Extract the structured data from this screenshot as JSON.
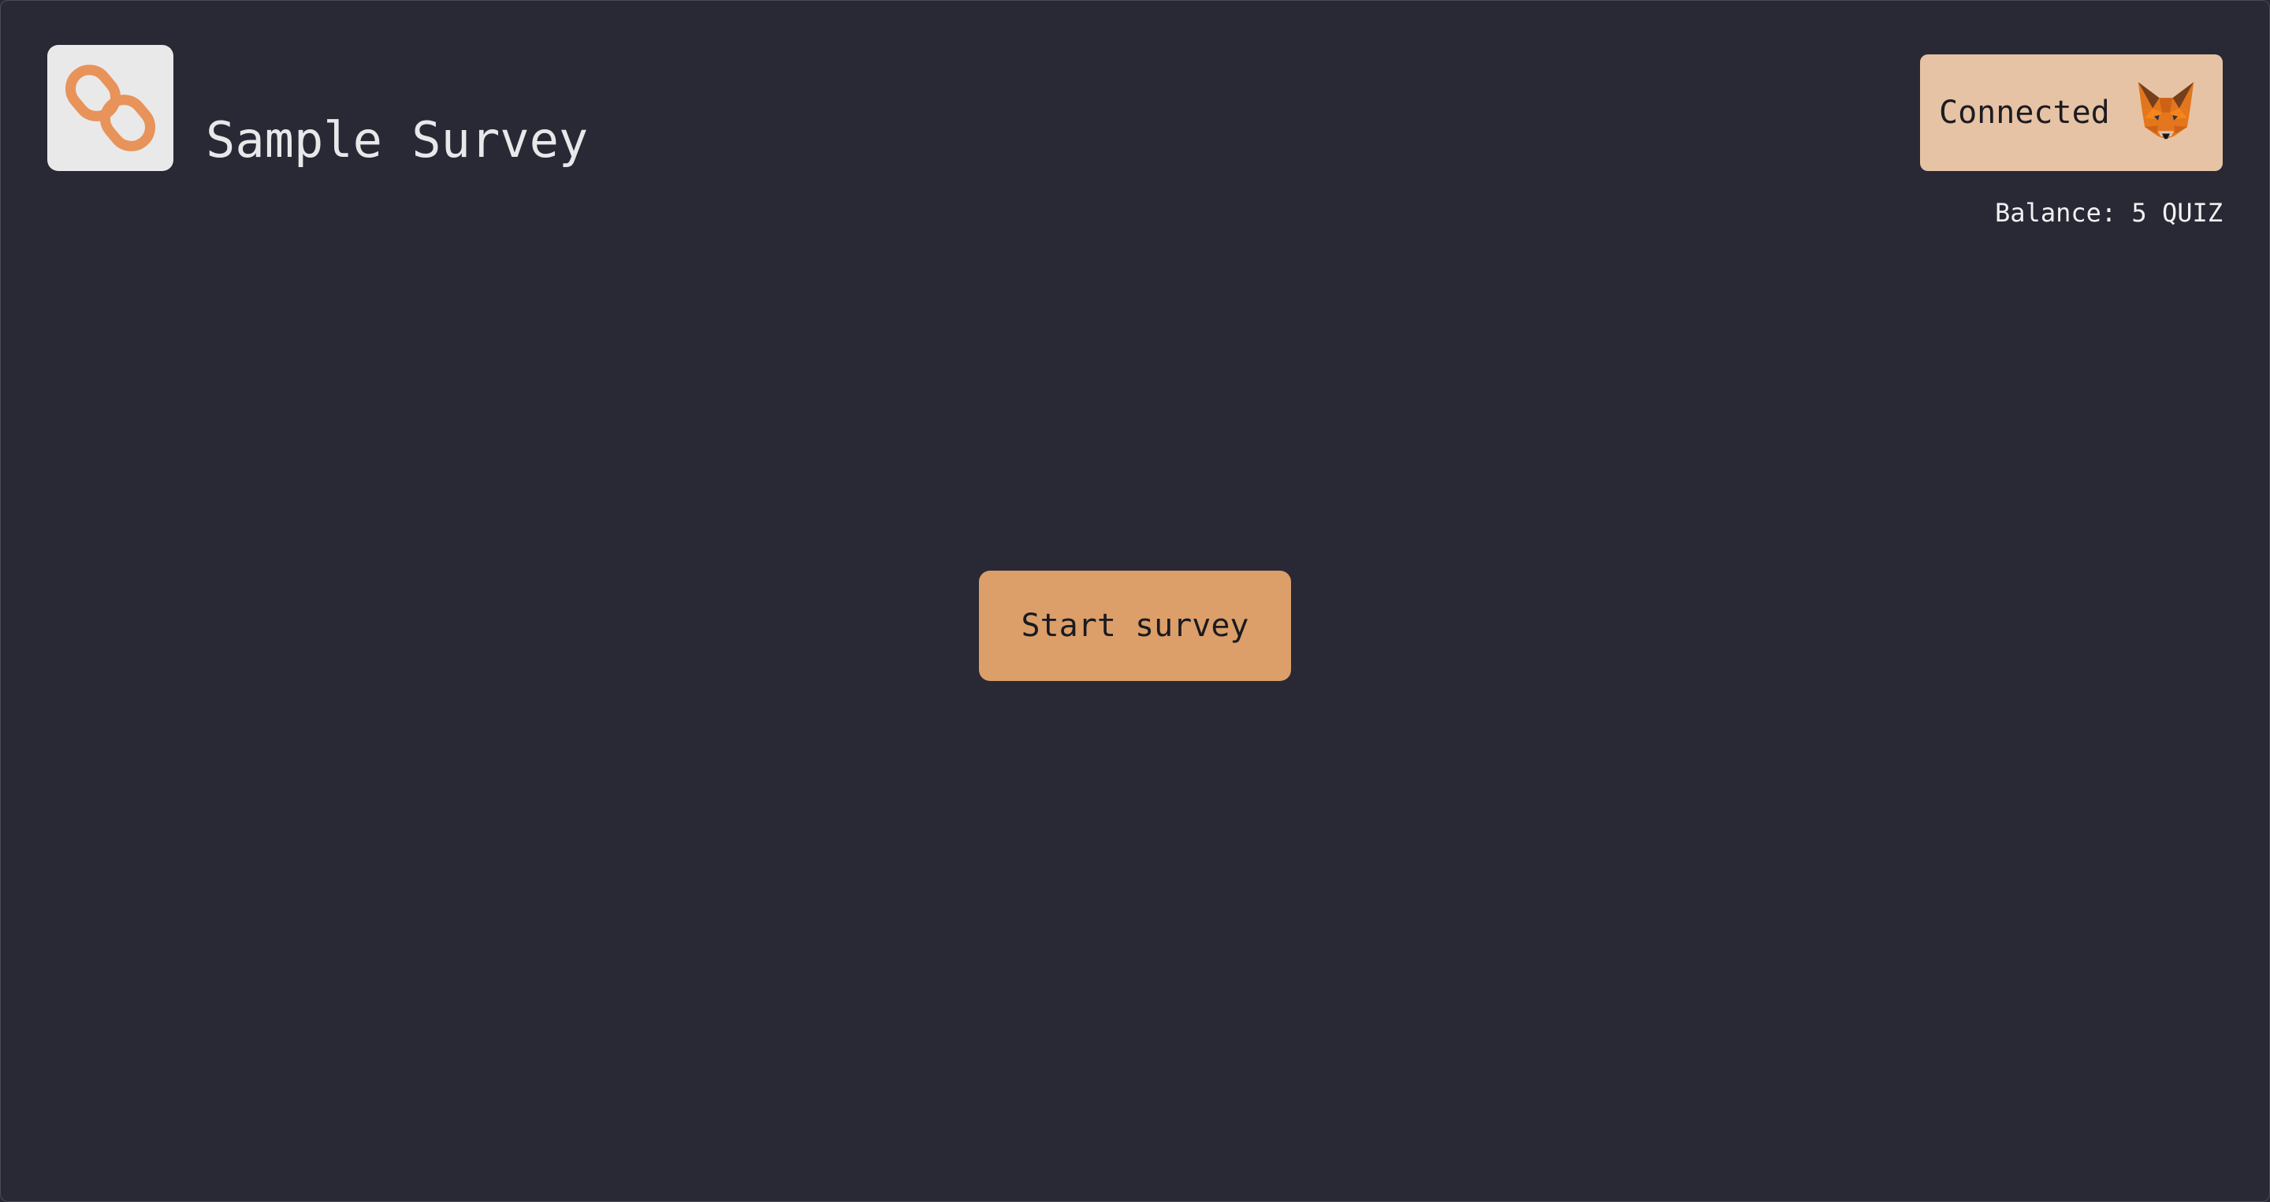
{
  "header": {
    "title": "Sample Survey",
    "logo_icon": "chain-link-icon"
  },
  "wallet": {
    "status_label": "Connected",
    "wallet_icon": "metamask-fox-icon",
    "balance_text": "Balance: 5 QUIZ"
  },
  "main": {
    "start_label": "Start survey"
  },
  "colors": {
    "background": "#282935",
    "accent": "#dc9f69",
    "wallet_button": "#e6c3a4",
    "logo_tile": "#e9e9ea",
    "text_light": "#e8e8ea"
  }
}
